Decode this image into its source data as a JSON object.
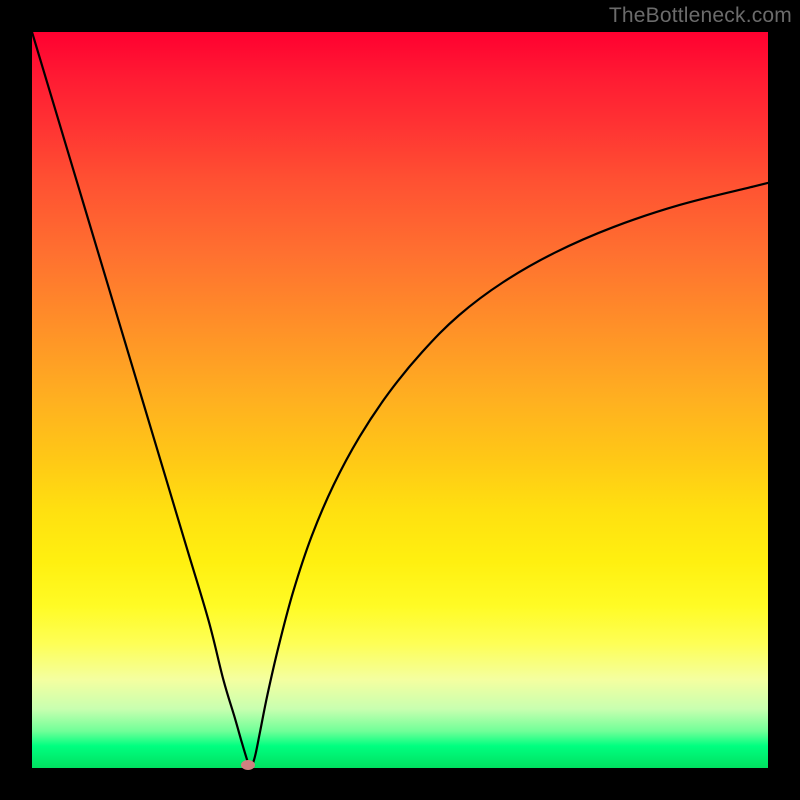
{
  "watermark": "TheBottleneck.com",
  "chart_data": {
    "type": "line",
    "title": "",
    "xlabel": "",
    "ylabel": "",
    "xlim": [
      0,
      100
    ],
    "ylim": [
      0,
      100
    ],
    "grid": false,
    "series": [
      {
        "name": "bottleneck-curve",
        "color": "#000000",
        "x": [
          0,
          3,
          6,
          9,
          12,
          15,
          18,
          21,
          24,
          26,
          27.5,
          28.5,
          29.1,
          29.4,
          29.7,
          30.0,
          30.4,
          31.0,
          32.0,
          33.5,
          35.5,
          38.0,
          41.0,
          44.5,
          48.5,
          53.0,
          58.0,
          64.0,
          71.0,
          79.0,
          88.0,
          98.0,
          100.0
        ],
        "values": [
          100,
          90.0,
          80.0,
          70.0,
          60.0,
          50.0,
          40.0,
          30.0,
          20.0,
          12.0,
          7.0,
          3.5,
          1.5,
          0.6,
          0.15,
          0.6,
          2.0,
          5.0,
          10.0,
          16.5,
          24.0,
          31.5,
          38.5,
          45.0,
          51.0,
          56.5,
          61.5,
          66.0,
          70.0,
          73.5,
          76.5,
          79.0,
          79.5
        ]
      }
    ],
    "marker": {
      "name": "minimum-point",
      "x": 29.4,
      "y": 0.4,
      "color": "#d08080"
    }
  }
}
